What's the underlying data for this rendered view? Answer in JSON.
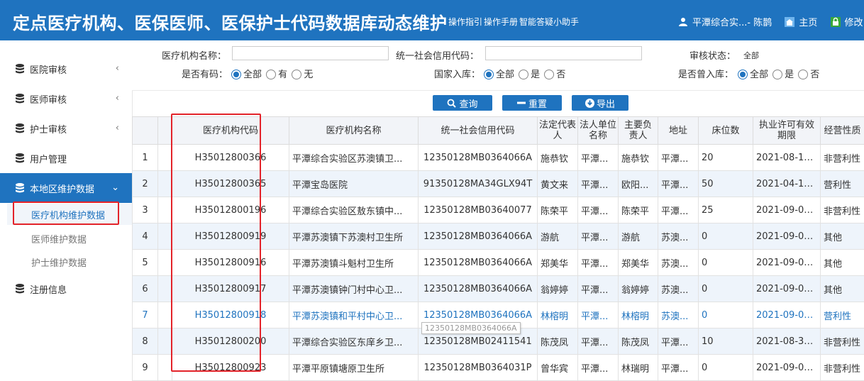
{
  "header": {
    "title": "定点医疗机构、医保医师、医保护士代码数据库动态维护",
    "links": [
      "操作指引",
      "操作手册",
      "智能答疑小助手"
    ],
    "user": "平潭综合实...- 陈鹊",
    "home": "主页",
    "password": "修改"
  },
  "sidebar": {
    "items": [
      {
        "label": "医院审核"
      },
      {
        "label": "医师审核"
      },
      {
        "label": "护士审核"
      },
      {
        "label": "用户管理"
      },
      {
        "label": "本地区维护数据"
      },
      {
        "label": "注册信息"
      }
    ],
    "subitems": [
      {
        "label": "医疗机构维护数据"
      },
      {
        "label": "医师维护数据"
      },
      {
        "label": "护士维护数据"
      }
    ]
  },
  "filters": {
    "org_name_label": "医疗机构名称：",
    "credit_label": "统一社会信用代码：",
    "status_label": "审核状态：",
    "status_value": "全部",
    "has_code_label": "是否有码：",
    "has_code_opts": [
      "全部",
      "有",
      "无"
    ],
    "national_label": "国家入库：",
    "national_opts": [
      "全部",
      "是",
      "否"
    ],
    "ever_label": "是否曾入库：",
    "ever_opts": [
      "全部",
      "是",
      "否"
    ]
  },
  "buttons": {
    "query": "查询",
    "reset": "重置",
    "export": "导出"
  },
  "table": {
    "headers": [
      "医疗机构代码",
      "医疗机构名称",
      "统一社会信用代码",
      "法定代表人",
      "法人单位名称",
      "主要负责人",
      "地址",
      "床位数",
      "执业许可有效期限",
      "经营性质"
    ],
    "rows": [
      {
        "no": "1",
        "code": "H35012800366",
        "name": "平潭综合实验区苏澳镇卫...",
        "credit": "12350128MB0364066A",
        "legal": "施恭钦",
        "unit": "平潭...",
        "head": "施恭钦",
        "addr": "平潭...",
        "beds": "20",
        "valid": "2021-08-13...",
        "nature": "非营利性"
      },
      {
        "no": "2",
        "code": "H35012800365",
        "name": "平潭宝岛医院",
        "credit": "91350128MA34GLX94T",
        "legal": "黄文来",
        "unit": "平潭...",
        "head": "欧阳...",
        "addr": "平潭...",
        "beds": "50",
        "valid": "2021-04-11...",
        "nature": "营利性"
      },
      {
        "no": "3",
        "code": "H35012800196",
        "name": "平潭综合实验区敖东镇中...",
        "credit": "12350128MB03640077",
        "legal": "陈荣平",
        "unit": "平潭...",
        "head": "陈荣平",
        "addr": "平潭...",
        "beds": "25",
        "valid": "2021-09-04...",
        "nature": "非营利性"
      },
      {
        "no": "4",
        "code": "H35012800919",
        "name": "平潭苏澳镇下苏澳村卫生所",
        "credit": "12350128MB0364066A",
        "legal": "游航",
        "unit": "平潭...",
        "head": "游航",
        "addr": "苏澳...",
        "beds": "0",
        "valid": "2021-09-04...",
        "nature": "其他"
      },
      {
        "no": "5",
        "code": "H35012800916",
        "name": "平潭苏澳镇斗魁村卫生所",
        "credit": "12350128MB0364066A",
        "legal": "郑美华",
        "unit": "平潭...",
        "head": "郑美华",
        "addr": "苏澳...",
        "beds": "0",
        "valid": "2021-09-04...",
        "nature": "其他"
      },
      {
        "no": "6",
        "code": "H35012800917",
        "name": "平潭苏澳镇钟门村中心卫...",
        "credit": "12350128MB0364066A",
        "legal": "翁婷婷",
        "unit": "平潭...",
        "head": "翁婷婷",
        "addr": "苏澳...",
        "beds": "0",
        "valid": "2021-09-07...",
        "nature": "其他"
      },
      {
        "no": "7",
        "code": "H35012800918",
        "name": "平潭苏澳镇和平村中心卫...",
        "credit": "12350128MB0364066A",
        "legal": "林榕明",
        "unit": "平潭...",
        "head": "林榕明",
        "addr": "苏澳...",
        "beds": "0",
        "valid": "2021-09-07...",
        "nature": "营利性"
      },
      {
        "no": "8",
        "code": "H35012800200",
        "name": "平潭综合实验区东庠乡卫...",
        "credit": "12350128MB02411541",
        "legal": "陈茂凤",
        "unit": "平潭...",
        "head": "陈茂凤",
        "addr": "平潭...",
        "beds": "10",
        "valid": "2021-08-30...",
        "nature": "非营利性"
      },
      {
        "no": "9",
        "code": "H35012800923",
        "name": "平潭平原镇塘原卫生所",
        "credit": "12350128MB0364031P",
        "legal": "曾华宾",
        "unit": "平潭...",
        "head": "林瑞明",
        "addr": "平潭...",
        "beds": "0",
        "valid": "2021-09-03...",
        "nature": "非营利性"
      }
    ]
  },
  "tooltip": "12350128MB0364066A",
  "colors": {
    "primary": "#1f73bf",
    "highlight": "#e3232a"
  }
}
